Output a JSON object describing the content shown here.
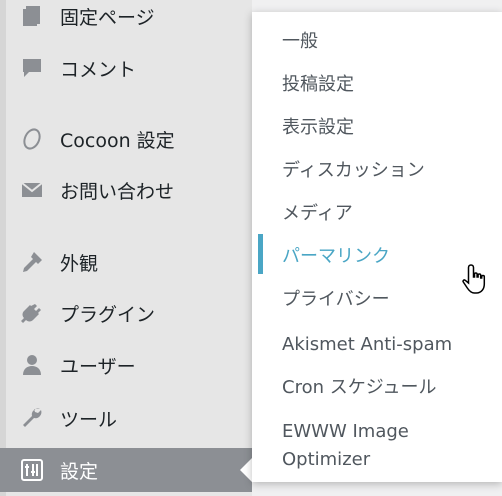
{
  "sidebar": {
    "items": [
      {
        "label": "固定ページ",
        "icon": "pages-icon"
      },
      {
        "label": "コメント",
        "icon": "comment-icon"
      },
      {
        "label": "Cocoon 設定",
        "icon": "cocoon-icon"
      },
      {
        "label": "お問い合わせ",
        "icon": "mail-icon"
      },
      {
        "label": "外観",
        "icon": "appearance-icon"
      },
      {
        "label": "プラグイン",
        "icon": "plugin-icon"
      },
      {
        "label": "ユーザー",
        "icon": "user-icon"
      },
      {
        "label": "ツール",
        "icon": "wrench-icon"
      },
      {
        "label": "設定",
        "icon": "settings-icon",
        "active": true
      }
    ]
  },
  "submenu": {
    "items": [
      {
        "label": "一般"
      },
      {
        "label": "投稿設定"
      },
      {
        "label": "表示設定"
      },
      {
        "label": "ディスカッション"
      },
      {
        "label": "メディア"
      },
      {
        "label": "パーマリンク",
        "current": true
      },
      {
        "label": "プライバシー"
      },
      {
        "label": "Akismet Anti-spam"
      },
      {
        "label": "Cron スケジュール"
      },
      {
        "label": "EWWW Image"
      },
      {
        "label": "Optimizer"
      }
    ]
  },
  "colors": {
    "current_accent": "#4aa6c5",
    "active_bg": "#8c8f94"
  }
}
